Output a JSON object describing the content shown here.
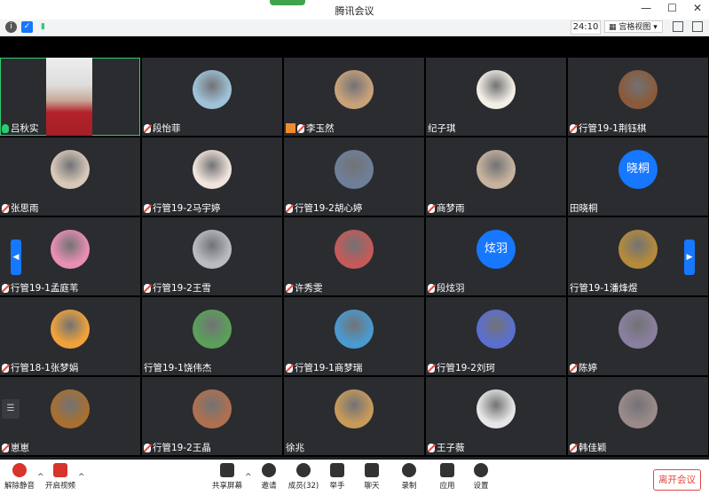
{
  "window": {
    "title": "腾讯会议"
  },
  "toolbar": {
    "timer": "24:10",
    "view_mode": "宫格视图"
  },
  "participants": [
    {
      "name": "吕秋实",
      "mic": "on",
      "avatar_type": "video",
      "active": true
    },
    {
      "name": "段怡菲",
      "mic": "muted",
      "avatar_type": "image",
      "color": "#9fc2d8"
    },
    {
      "name": "李玉然",
      "mic": "muted",
      "avatar_type": "image",
      "color": "#c9a27a",
      "host": true
    },
    {
      "name": "纪子琪",
      "mic": "none",
      "avatar_type": "image",
      "color": "#f3efe6"
    },
    {
      "name": "行管19-1荆钰棋",
      "mic": "muted",
      "avatar_type": "image",
      "color": "#8a5a3a"
    },
    {
      "name": "张思雨",
      "mic": "muted",
      "avatar_type": "image",
      "color": "#d9c8b8"
    },
    {
      "name": "行管19-2马宇婷",
      "mic": "muted",
      "avatar_type": "image",
      "color": "#f1e4dc"
    },
    {
      "name": "行管19-2胡心婷",
      "mic": "muted",
      "avatar_type": "image",
      "color": "#6f7f99"
    },
    {
      "name": "商梦雨",
      "mic": "muted",
      "avatar_type": "image",
      "color": "#c7b39e"
    },
    {
      "name": "田晓桐",
      "mic": "none",
      "avatar_type": "text",
      "avatar_text": "晓桐",
      "color": "#1677ff"
    },
    {
      "name": "行管19-1孟庭苇",
      "mic": "muted",
      "avatar_type": "image",
      "color": "#e98fb1"
    },
    {
      "name": "行管19-2王雪",
      "mic": "muted",
      "avatar_type": "image",
      "color": "#b8bcc0"
    },
    {
      "name": "许秀雯",
      "mic": "muted",
      "avatar_type": "image",
      "color": "#c45a5a"
    },
    {
      "name": "段炫羽",
      "mic": "muted",
      "avatar_type": "text",
      "avatar_text": "炫羽",
      "color": "#1677ff"
    },
    {
      "name": "行管19-1潘烽煜",
      "mic": "none",
      "avatar_type": "image",
      "color": "#b58a3a"
    },
    {
      "name": "行管18-1张梦娟",
      "mic": "muted",
      "avatar_type": "image",
      "color": "#f0a23a"
    },
    {
      "name": "行管19-1饶伟杰",
      "mic": "none",
      "avatar_type": "image",
      "color": "#5aa05a"
    },
    {
      "name": "行管19-1商梦瑞",
      "mic": "muted",
      "avatar_type": "image",
      "color": "#4a9ad0"
    },
    {
      "name": "行管19-2刘珂",
      "mic": "muted",
      "avatar_type": "image",
      "color": "#5a6fd0"
    },
    {
      "name": "陈婷",
      "mic": "muted",
      "avatar_type": "image",
      "color": "#8a7fa0"
    },
    {
      "name": "崽崽",
      "mic": "muted",
      "avatar_type": "image",
      "color": "#a8702f"
    },
    {
      "name": "行管19-2王晶",
      "mic": "muted",
      "avatar_type": "image",
      "color": "#b07050"
    },
    {
      "name": "徐兆",
      "mic": "none",
      "avatar_type": "image",
      "color": "#c89a5a"
    },
    {
      "name": "王子薇",
      "mic": "muted",
      "avatar_type": "image",
      "color": "#e6e6e6"
    },
    {
      "name": "韩佳颖",
      "mic": "muted",
      "avatar_type": "image",
      "color": "#9a8a8a"
    }
  ],
  "bottom_bar": {
    "mute": "解除静音",
    "video": "开启视频",
    "share": "共享屏幕",
    "invite": "邀请",
    "members": "成员(32)",
    "raise_hand": "举手",
    "chat": "聊天",
    "record": "录制",
    "apps": "应用",
    "settings": "设置",
    "leave": "离开会议"
  }
}
